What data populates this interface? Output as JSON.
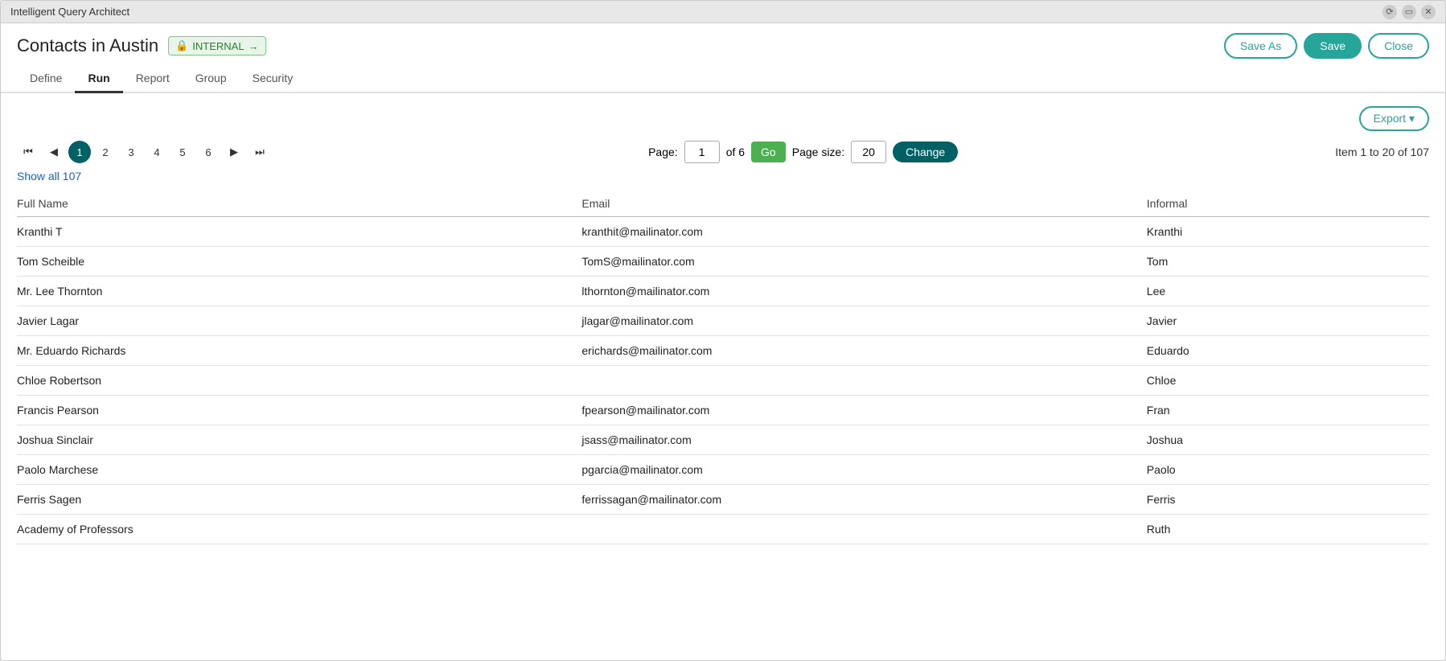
{
  "app": {
    "title": "Intelligent Query Architect"
  },
  "header": {
    "page_title": "Contacts in Austin",
    "badge_text": "INTERNAL",
    "badge_arrow": "→",
    "save_as_label": "Save As",
    "save_label": "Save",
    "close_label": "Close"
  },
  "tabs": [
    {
      "id": "define",
      "label": "Define",
      "active": false
    },
    {
      "id": "run",
      "label": "Run",
      "active": true
    },
    {
      "id": "report",
      "label": "Report",
      "active": false
    },
    {
      "id": "group",
      "label": "Group",
      "active": false
    },
    {
      "id": "security",
      "label": "Security",
      "active": false
    }
  ],
  "toolbar": {
    "export_label": "Export ▾"
  },
  "pagination": {
    "current_page": "1",
    "total_pages": "6",
    "of_text": "of 6",
    "page_label": "Page:",
    "page_size_label": "Page size:",
    "page_size": "20",
    "go_label": "Go",
    "change_label": "Change",
    "item_summary": "Item 1 to 20 of 107",
    "show_all_label": "Show all 107",
    "pages": [
      "1",
      "2",
      "3",
      "4",
      "5",
      "6"
    ]
  },
  "table": {
    "columns": [
      {
        "id": "full_name",
        "label": "Full Name"
      },
      {
        "id": "email",
        "label": "Email"
      },
      {
        "id": "informal",
        "label": "Informal"
      }
    ],
    "rows": [
      {
        "full_name": "Kranthi T",
        "email": "kranthit@mailinator.com",
        "informal": "Kranthi"
      },
      {
        "full_name": "Tom Scheible",
        "email": "TomS@mailinator.com",
        "informal": "Tom"
      },
      {
        "full_name": "Mr. Lee Thornton",
        "email": "lthornton@mailinator.com",
        "informal": "Lee"
      },
      {
        "full_name": "Javier Lagar",
        "email": "jlagar@mailinator.com",
        "informal": "Javier"
      },
      {
        "full_name": "Mr. Eduardo Richards",
        "email": "erichards@mailinator.com",
        "informal": "Eduardo"
      },
      {
        "full_name": "Chloe Robertson",
        "email": "",
        "informal": "Chloe"
      },
      {
        "full_name": "Francis Pearson",
        "email": "fpearson@mailinator.com",
        "informal": "Fran"
      },
      {
        "full_name": "Joshua Sinclair",
        "email": "jsass@mailinator.com",
        "informal": "Joshua"
      },
      {
        "full_name": "Paolo Marchese",
        "email": "pgarcia@mailinator.com",
        "informal": "Paolo"
      },
      {
        "full_name": "Ferris Sagen",
        "email": "ferrissagan@mailinator.com",
        "informal": "Ferris"
      },
      {
        "full_name": "Academy of Professors",
        "email": "",
        "informal": "Ruth"
      }
    ]
  }
}
